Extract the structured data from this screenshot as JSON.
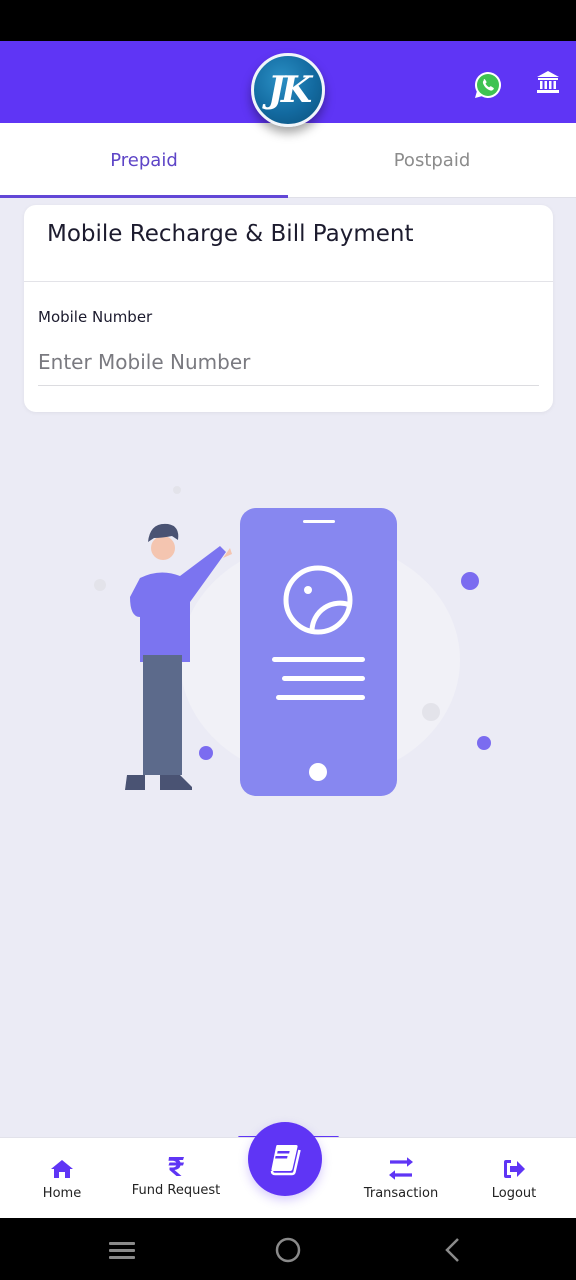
{
  "header": {
    "logo_text": "JK",
    "icons": [
      "whatsapp-icon",
      "bank-icon"
    ],
    "brand_color": "#5f35f5"
  },
  "tabs": [
    {
      "label": "Prepaid",
      "active": true
    },
    {
      "label": "Postpaid",
      "active": false
    }
  ],
  "card": {
    "title": "Mobile Recharge & Bill Payment",
    "field_label": "Mobile Number",
    "field_placeholder": "Enter Mobile Number",
    "field_value": ""
  },
  "bottom_nav": {
    "items": [
      {
        "label": "Home",
        "icon": "home-icon"
      },
      {
        "label": "Fund Request",
        "icon": "rupee-icon"
      },
      {
        "label": "Transaction",
        "icon": "transfer-arrows-icon"
      },
      {
        "label": "Logout",
        "icon": "logout-icon"
      }
    ],
    "center_icon": "book-icon"
  },
  "system_nav": [
    "recents-icon",
    "home-circle-icon",
    "back-icon"
  ]
}
